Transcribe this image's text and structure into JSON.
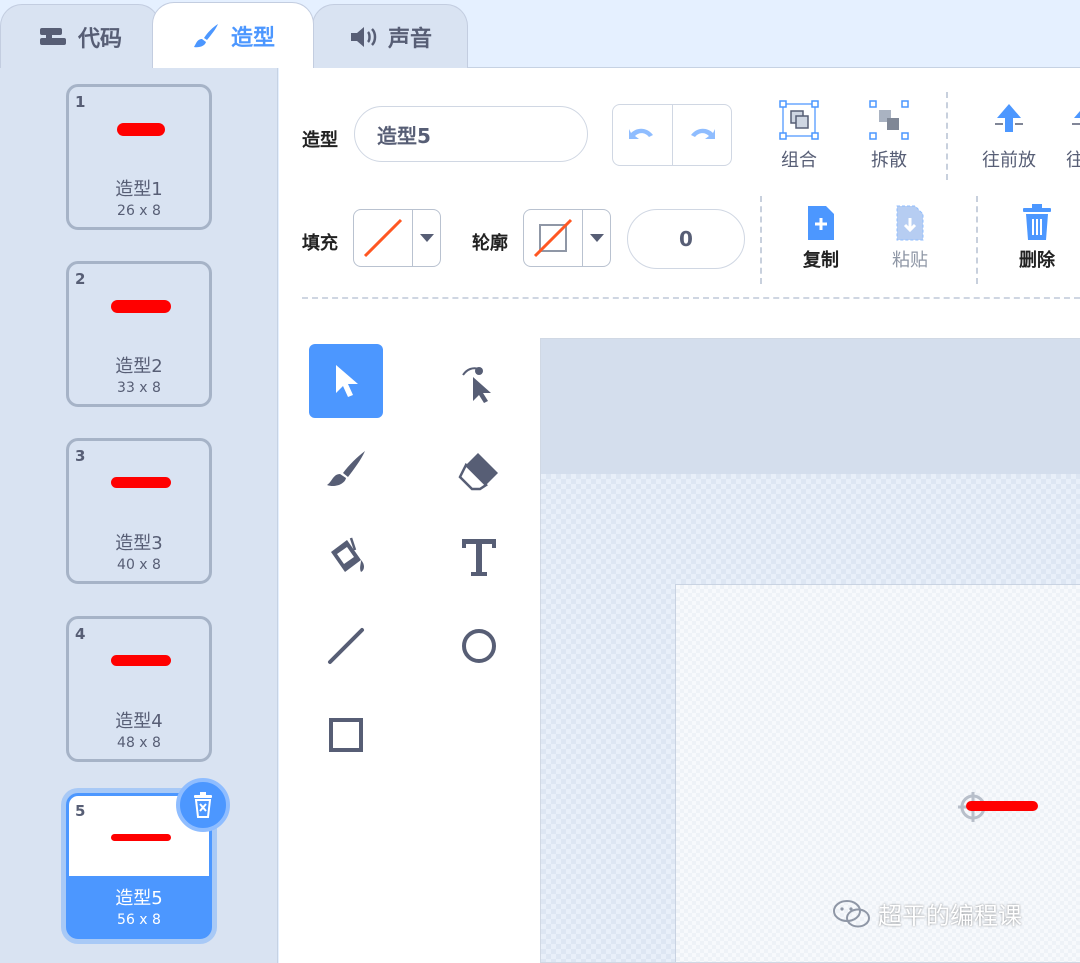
{
  "tabs": [
    {
      "label": "代码",
      "icon": "code-blocks-icon"
    },
    {
      "label": "造型",
      "icon": "paintbrush-icon",
      "active": true
    },
    {
      "label": "声音",
      "icon": "speaker-icon"
    }
  ],
  "costumes": [
    {
      "num": "1",
      "name": "造型1",
      "size": "26 x 8"
    },
    {
      "num": "2",
      "name": "造型2",
      "size": "33 x 8"
    },
    {
      "num": "3",
      "name": "造型3",
      "size": "40 x 8"
    },
    {
      "num": "4",
      "name": "造型4",
      "size": "48 x 8"
    },
    {
      "num": "5",
      "name": "造型5",
      "size": "56 x 8",
      "selected": true
    }
  ],
  "editor": {
    "costume_label": "造型",
    "costume_name": "造型5",
    "group_label": "组合",
    "ungroup_label": "拆散",
    "forward_label": "往前放",
    "forward2_label": "往",
    "fill_label": "填充",
    "outline_label": "轮廓",
    "outline_width": "0",
    "copy_label": "复制",
    "paste_label": "粘贴",
    "delete_label": "删除"
  },
  "tools": [
    "select",
    "reshape",
    "brush",
    "eraser",
    "fill",
    "text",
    "line",
    "circle",
    "rectangle"
  ],
  "colors": {
    "accent": "#4c97ff",
    "stroke_red": "#ff0000",
    "fill_swatch": "#ff5722"
  },
  "watermark": "超平的编程课"
}
